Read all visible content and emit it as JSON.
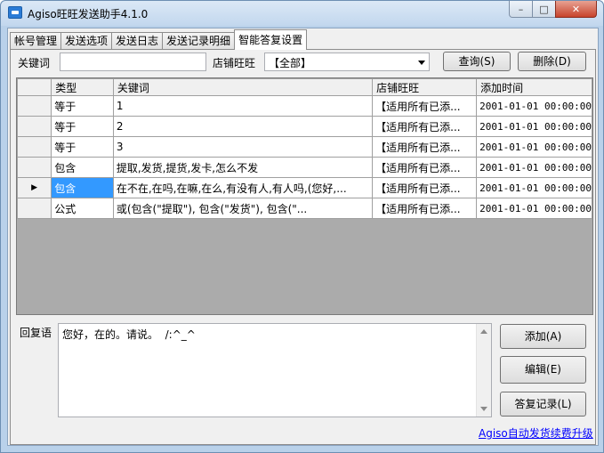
{
  "window": {
    "title": "Agiso旺旺发送助手4.1.0",
    "controls": {
      "min": "–",
      "max": "□",
      "close": "✕"
    }
  },
  "tabs": [
    {
      "label": "帐号管理"
    },
    {
      "label": "发送选项"
    },
    {
      "label": "发送日志"
    },
    {
      "label": "发送记录明细"
    },
    {
      "label": "智能答复设置",
      "active": true
    }
  ],
  "search": {
    "keyword_label": "关键词",
    "keyword_value": "",
    "shop_label": "店铺旺旺",
    "shop_selected": "【全部】",
    "query_button": "查询(S)",
    "delete_button": "删除(D)"
  },
  "grid": {
    "columns": [
      "类型",
      "关键词",
      "店铺旺旺",
      "添加时间"
    ],
    "rows": [
      {
        "type": "等于",
        "keyword": "1",
        "shop": "【适用所有已添...",
        "time": "2001-01-01 00:00:00"
      },
      {
        "type": "等于",
        "keyword": "2",
        "shop": "【适用所有已添...",
        "time": "2001-01-01 00:00:00"
      },
      {
        "type": "等于",
        "keyword": "3",
        "shop": "【适用所有已添...",
        "time": "2001-01-01 00:00:00"
      },
      {
        "type": "包含",
        "keyword": "提取,发货,提货,发卡,怎么不发",
        "shop": "【适用所有已添...",
        "time": "2001-01-01 00:00:00"
      },
      {
        "type": "包含",
        "keyword": "在不在,在吗,在嘛,在么,有没有人,有人吗,(您好,...",
        "shop": "【适用所有已添...",
        "time": "2001-01-01 00:00:00",
        "selected": true,
        "current_marker": "▶"
      },
      {
        "type": "公式",
        "keyword": "或(包含(\"提取\"), 包含(\"发货\"), 包含(\"...",
        "shop": "【适用所有已添...",
        "time": "2001-01-01 00:00:00"
      }
    ]
  },
  "reply": {
    "label": "回复语",
    "text": "您好，在的。请说。  /:^_^",
    "add_button": "添加(A)",
    "edit_button": "编辑(E)",
    "history_button": "答复记录(L)"
  },
  "footer": {
    "link": "Agiso自动发货续费升级"
  },
  "colors": {
    "selection": "#3399ff",
    "link": "#0000ff",
    "close_button": "#c7432b"
  }
}
